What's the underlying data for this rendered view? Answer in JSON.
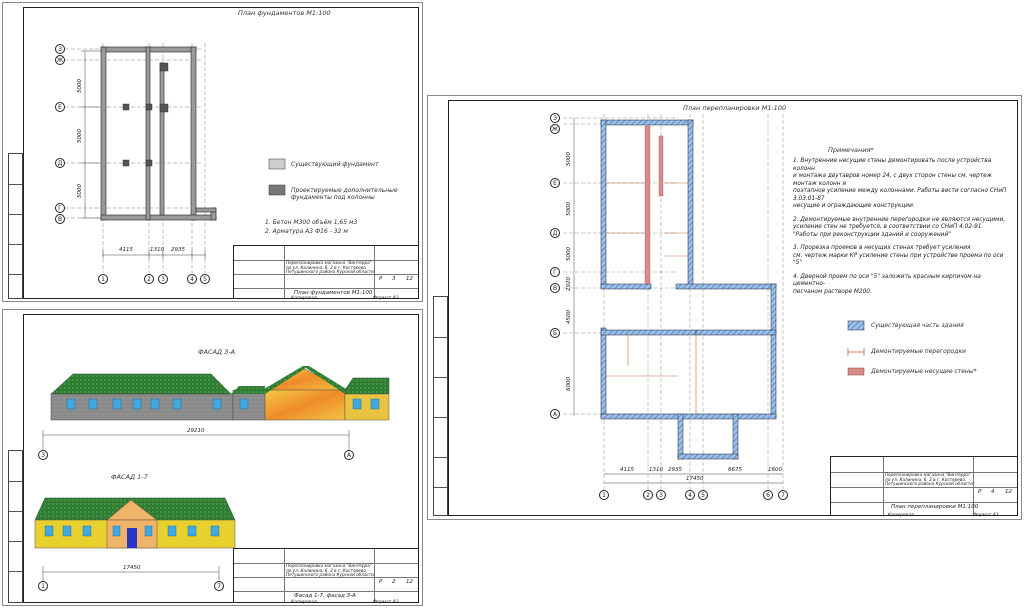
{
  "sheet1": {
    "title": "План фундаментов М1:100",
    "legend": [
      {
        "label": "Существующий фундамент"
      },
      {
        "label": "Проектируемые дополнительные фундаменты под колонны"
      }
    ],
    "spec": [
      "1. Бетон М300 объём 1,65 м3",
      "2. Арматура А3 Ф16 - 32 м"
    ],
    "dims_bottom": [
      "4115",
      "1310",
      "2935"
    ],
    "dims_left": [
      "5000",
      "5000",
      "5000"
    ],
    "axes_bottom": [
      "1",
      "2",
      "3",
      "4",
      "5"
    ],
    "axes_left": [
      "З",
      "Ж",
      "Е",
      "Д",
      "Г",
      "В"
    ],
    "stamp": {
      "project": "Перепланировка магазина \"Винтерра\" по ул. Калинина, 6, 2 в г. Костерево, Петушинского района Курской области",
      "sheet_name": "План фундаментов М1:100",
      "stage": "Р",
      "sheet_no": "3",
      "sheets": "12",
      "copied": "Копировал",
      "format": "Формат А3"
    }
  },
  "sheet2": {
    "facade1_title": "ФАСАД З-А",
    "facade1_dim": "29210",
    "facade1_axes": [
      "З",
      "А"
    ],
    "facade2_title": "ФАСАД 1-7",
    "facade2_dim": "17450",
    "facade2_axes": [
      "1",
      "7"
    ],
    "stamp": {
      "project": "Перепланировка магазина \"Винтерра\" по ул. Калинина, 6, 2 в г. Костерево, Петушинского района Курской области",
      "sheet_name": "Фасад 1-7, фасад З-А",
      "stage": "Р",
      "sheet_no": "2",
      "sheets": "12",
      "copied": "Копировал",
      "format": "Формат А3"
    }
  },
  "sheet3": {
    "title": "План перепланировки М1:100",
    "notes_title": "Примечания*",
    "notes": [
      "1. Внутренние несущие стены демонтировать после устройства колонн",
      "и монтажа двутавров номер 24, с двух сторон стены см. чертеж монтаж колонн и",
      "поэтапное усиление между колоннами. Работы вести согласно СНиП 3.03.01-87",
      "несущие и ограждающие конструкции.",
      "2. Демонтируемые внутренние перегородки не являются несущими,",
      "усиление стен не требуется, в соответствии со СНиП 4.02-91",
      "\"Работы при реконструкции зданий и сооружений\"",
      "3. Прорезка проемов в несущих стенах требует усиления",
      "см. чертеж марки КР усиление стены при устройстве проема по оси \"5\"",
      "4. Дверной проем по оси \"5\" заложить красным кирпичом на цементно-",
      "песчаном растворе М200."
    ],
    "legend": [
      {
        "label": "Существующая часть здания"
      },
      {
        "label": "Демонтируемые перегородки"
      },
      {
        "label": "Демонтируемые несущие стены*"
      }
    ],
    "dims_bottom": [
      "4115",
      "1310",
      "2935",
      "6675",
      "1600"
    ],
    "dim_total": "17450",
    "dims_left": [
      "5000",
      "5000",
      "5000",
      "2920",
      "4500",
      "6000"
    ],
    "axes_bottom": [
      "1",
      "2",
      "3",
      "4",
      "5",
      "6",
      "7"
    ],
    "axes_left": [
      "З",
      "Ж",
      "Е",
      "Д",
      "Г",
      "В",
      "Б",
      "А"
    ],
    "stamp": {
      "project": "Перепланировка магазина \"Винтерра\" по ул. Калинина, 6, 2 в г. Костерево, Петушинского района Курской области",
      "sheet_name": "План перепланировки М1:100",
      "stage": "Р",
      "sheet_no": "4",
      "sheets": "12",
      "copied": "Копировал",
      "format": "Формат А3"
    }
  },
  "colors": {
    "roof_green": "#2f7d32",
    "wall_grey": "#8c8c8c",
    "wall_orange": "#f2a33a",
    "window_blue": "#3fa9e0",
    "wall_yellow": "#e8d12e",
    "door_blue": "#2a36c8",
    "hatch_blue": "#4a7fc1",
    "demolish_red": "#d98b8b"
  }
}
